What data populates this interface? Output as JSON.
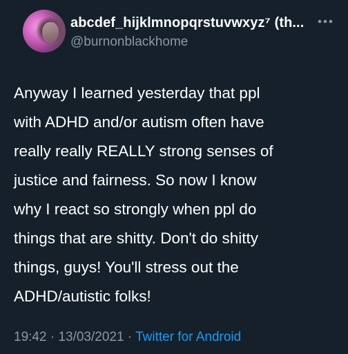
{
  "tweet": {
    "author": {
      "display_name": "abcdef_hijklmnopqrstuvwxyz⁷ (th...",
      "handle": "@burnonblackhome",
      "avatar_icon": "avatar-photo-icon"
    },
    "more_icon": "more-options-icon",
    "text_lines": [
      "Anyway I learned yesterday that ppl",
      "with ADHD and/or autism often have",
      "really really REALLY strong senses of",
      "justice and fairness. So now I know",
      "why I react so strongly when ppl do",
      "things that are shitty. Don't do shitty",
      "things, guys! You'll stress out the",
      "ADHD/autistic folks!"
    ],
    "time": "19:42",
    "date": "13/03/2021",
    "separator": " · ",
    "source": "Twitter for Android"
  },
  "colors": {
    "background": "#15202b",
    "text_primary": "#ffffff",
    "text_secondary": "#8b98a5",
    "link": "#1d9bf0"
  }
}
